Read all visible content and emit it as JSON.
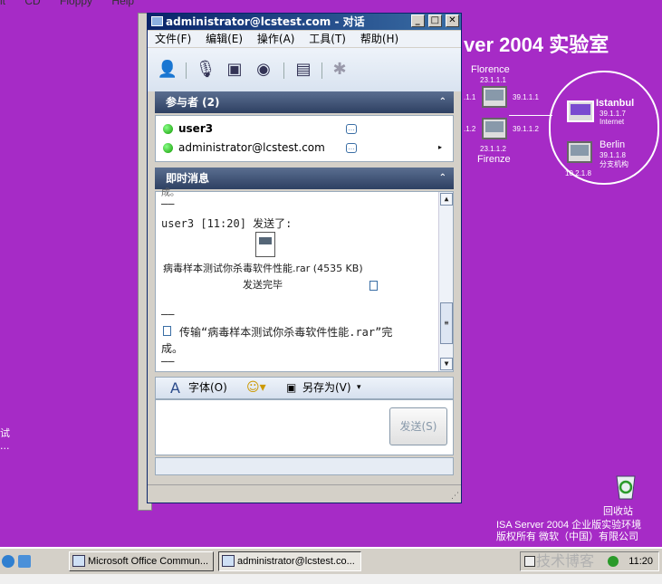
{
  "host_menu": [
    "lt",
    "CD",
    "Floppy",
    "Help"
  ],
  "desktop": {
    "banner": "ver 2004 实验室",
    "left_labels": [
      "试",
      "..."
    ],
    "network": {
      "florence_name": "Florence",
      "florence_ip": "23.1.1.1",
      "florence_ip_right": "39.1.1.1",
      "florence_ip_left": ".1.1",
      "firenze_ip_left": ".1.2",
      "firenze_ip_right": "39.1.1.2",
      "firenze_ip": "23.1.1.2",
      "firenze_name": "Firenze",
      "istanbul_name": "Istanbul",
      "istanbul_ip": "39.1.1.7",
      "istanbul_sub": "Internet",
      "berlin_name": "Berlin",
      "berlin_ip": "39.1.1.8",
      "berlin_sub": "分支机构",
      "berlin_lan": "10.2.1.8"
    },
    "recycle_bin": "回收站",
    "isa_line1": "ISA Server 2004 企业版实验环境",
    "isa_line2": "版权所有 微软（中国）有限公司"
  },
  "window": {
    "title": "administrator@lcstest.com - 对话",
    "menu": [
      "文件(F)",
      "编辑(E)",
      "操作(A)",
      "工具(T)",
      "帮助(H)"
    ],
    "participants_header": "参与者 (2)",
    "participants": [
      "user3",
      "administrator@lcstest.com"
    ],
    "im_header": "即时消息",
    "im": {
      "top_cut": "成。",
      "sep1": "——",
      "sender_line": "user3 [11:20] 发送了:",
      "file_name": "病毒样本测试你杀毒软件性能.rar (4535 KB)",
      "file_status": "发送完毕",
      "sep2": "——",
      "transfer_line1": "传输“病毒样本测试你杀毒软件性能.rar”完",
      "transfer_line2": "成。",
      "sep3": "——"
    },
    "format": {
      "font": "字体(O)",
      "save_as": "另存为(V)"
    },
    "send": "发送(S)"
  },
  "taskbar": {
    "items": [
      "Microsoft Office Commun...",
      "administrator@lcstest.co..."
    ],
    "clock": "11:20"
  },
  "watermark": "技术博客"
}
